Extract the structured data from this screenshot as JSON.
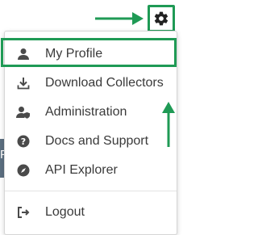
{
  "menu": {
    "items": [
      {
        "label": "My Profile",
        "icon": "person-icon"
      },
      {
        "label": "Download Collectors",
        "icon": "download-icon"
      },
      {
        "label": "Administration",
        "icon": "admin-user-icon"
      },
      {
        "label": "Docs and Support",
        "icon": "help-circle-icon"
      },
      {
        "label": "API Explorer",
        "icon": "compass-icon"
      }
    ],
    "logout_label": "Logout"
  },
  "background_text": "P",
  "colors": {
    "annotation_green": "#1f9a55",
    "icon_gray": "#4a4a4a",
    "text": "#3a3a3a",
    "background_strip": "#5c6f80"
  }
}
